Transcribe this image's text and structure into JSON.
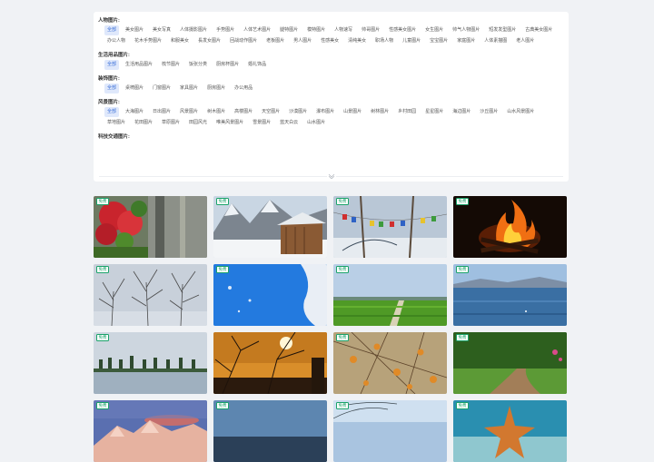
{
  "categories": [
    {
      "title": "人物图片:",
      "tags": [
        "全部",
        "美女图片",
        "美女写真",
        "人体摄影图片",
        "手势图片",
        "人体艺术图片",
        "腿特图片",
        "模特图片",
        "人物速写",
        "帅哥图片",
        "性感美女图片",
        "女生图片",
        "帅气人物图片",
        "短发发型图片",
        "古典美女图片",
        "办公人物",
        "花木手势图片",
        "和服美女",
        "長发女图片",
        "回战动作图片",
        "老板图片",
        "男人图片",
        "性感美女",
        "清纯美女",
        "职场人物",
        "儿童图片",
        "宝宝图片",
        "家庭图片",
        "人体素描图",
        "老人图片"
      ],
      "active": 0
    },
    {
      "title": "生活用品图片:",
      "tags": [
        "全部",
        "生活用品图片",
        "梳节图片",
        "饭张分类",
        "厨房杯图片",
        "婚礼饰品"
      ],
      "active": 0
    },
    {
      "title": "装饰图片:",
      "tags": [
        "全部",
        "桌椅图片",
        "门窗图片",
        "家具图片",
        "厨房图片",
        "办公用品"
      ],
      "active": 0
    },
    {
      "title": "风景图片:",
      "tags": [
        "全部",
        "大海图片",
        "日出图片",
        "风景图片",
        "树木图片",
        "高楼图片",
        "天空图片",
        "沙漠图片",
        "瀑布图片",
        "山景图片",
        "树林图片",
        "乡村田园",
        "星星图片",
        "海边图片",
        "沙丘图片",
        "山水风景图片",
        "草地图片",
        "花田图片",
        "草原图片",
        "田园风光",
        "唯美风景图片",
        "雪景图片",
        "蓝天白云",
        "山水图片"
      ],
      "active": 0
    },
    {
      "title": "科技交通图片:",
      "tags": [],
      "active": -1
    }
  ],
  "badge_label": "免费",
  "images": [
    {
      "scene": "red-tree"
    },
    {
      "scene": "snow-cabin"
    },
    {
      "scene": "prayer-flags"
    },
    {
      "scene": "campfire"
    },
    {
      "scene": "bare-trees"
    },
    {
      "scene": "blue-sky"
    },
    {
      "scene": "green-field"
    },
    {
      "scene": "lake"
    },
    {
      "scene": "shore-trees"
    },
    {
      "scene": "sunset"
    },
    {
      "scene": "fruit-tree"
    },
    {
      "scene": "forest-path"
    },
    {
      "scene": "mountain-glow"
    },
    {
      "scene": "city-blue"
    },
    {
      "scene": "sky-tree"
    },
    {
      "scene": "starfish"
    }
  ]
}
